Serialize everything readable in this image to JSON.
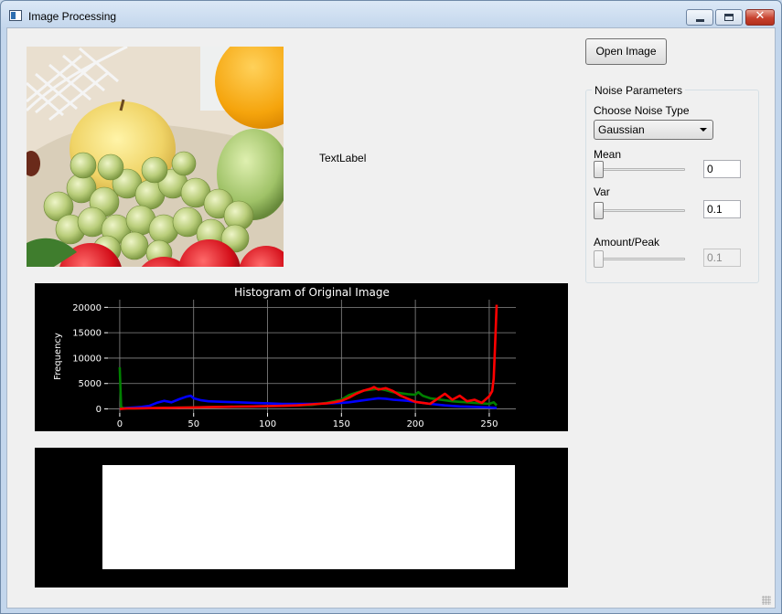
{
  "window": {
    "title": "Image Processing",
    "icon": "app-window-icon",
    "controls": {
      "minimize": "minimize-icon",
      "maximize": "maximize-icon",
      "close": "✕"
    }
  },
  "image_panel": {
    "content": "photo of fruit: grapes, apple, orange, custard apple, tomatoes, tennis racket"
  },
  "text_label": "TextLabel",
  "open_button": "Open Image",
  "noise": {
    "group_title": "Noise Parameters",
    "type_label": "Choose Noise Type",
    "type_value": "Gaussian",
    "mean_label": "Mean",
    "mean_value": "0",
    "mean_slider": 0,
    "var_label": "Var",
    "var_value": "0.1",
    "var_slider": 0,
    "amount_label": "Amount/Peak",
    "amount_value": "0.1",
    "amount_slider": 0,
    "amount_enabled": false
  },
  "chart_data": {
    "type": "line",
    "title": "Histogram of Original Image",
    "xlabel": "",
    "ylabel": "Frequency",
    "xlim": [
      -8,
      268
    ],
    "ylim": [
      -800,
      21500
    ],
    "xticks": [
      0,
      50,
      100,
      150,
      200,
      250
    ],
    "yticks": [
      0,
      5000,
      10000,
      15000,
      20000
    ],
    "grid": true,
    "series": [
      {
        "color": "#0000ff",
        "x": [
          0,
          5,
          10,
          15,
          20,
          25,
          30,
          35,
          40,
          45,
          48,
          50,
          55,
          60,
          70,
          80,
          90,
          100,
          110,
          120,
          130,
          140,
          150,
          155,
          160,
          165,
          170,
          175,
          180,
          185,
          190,
          195,
          200,
          210,
          220,
          230,
          240,
          250,
          255
        ],
        "y": [
          100,
          200,
          300,
          400,
          600,
          1200,
          1600,
          1300,
          1900,
          2400,
          2600,
          2100,
          1700,
          1500,
          1400,
          1300,
          1200,
          1100,
          1000,
          1000,
          1000,
          1100,
          1200,
          1300,
          1500,
          1700,
          1900,
          2100,
          2000,
          1800,
          1700,
          1600,
          1400,
          1000,
          700,
          500,
          400,
          300,
          200
        ]
      },
      {
        "color": "#008000",
        "x": [
          0,
          0.5,
          1,
          3,
          10,
          20,
          30,
          50,
          70,
          90,
          110,
          130,
          140,
          150,
          155,
          160,
          165,
          170,
          175,
          180,
          185,
          190,
          195,
          200,
          202,
          205,
          210,
          220,
          225,
          230,
          240,
          250,
          253,
          255
        ],
        "y": [
          8200,
          4000,
          300,
          100,
          100,
          150,
          200,
          300,
          400,
          500,
          600,
          800,
          1200,
          1800,
          2700,
          3200,
          3600,
          3800,
          4000,
          3700,
          3300,
          3100,
          2900,
          2800,
          3300,
          2600,
          2100,
          1700,
          1500,
          1400,
          1200,
          1000,
          1300,
          700
        ]
      },
      {
        "color": "#ff0000",
        "x": [
          0,
          5,
          10,
          20,
          30,
          40,
          50,
          60,
          70,
          80,
          90,
          100,
          110,
          120,
          130,
          140,
          145,
          150,
          155,
          160,
          165,
          170,
          172,
          175,
          180,
          185,
          190,
          195,
          200,
          205,
          210,
          215,
          220,
          225,
          230,
          235,
          240,
          245,
          250,
          252,
          253,
          254,
          255
        ],
        "y": [
          0,
          100,
          100,
          150,
          200,
          250,
          300,
          350,
          400,
          450,
          500,
          550,
          600,
          700,
          900,
          1100,
          1300,
          1600,
          2200,
          3000,
          3600,
          4000,
          4300,
          3800,
          4100,
          3500,
          2600,
          2000,
          1400,
          1200,
          1000,
          2000,
          3000,
          1800,
          2600,
          1500,
          1800,
          1200,
          2500,
          3500,
          6000,
          13000,
          20500
        ]
      }
    ]
  },
  "second_plot": {
    "content": ""
  }
}
